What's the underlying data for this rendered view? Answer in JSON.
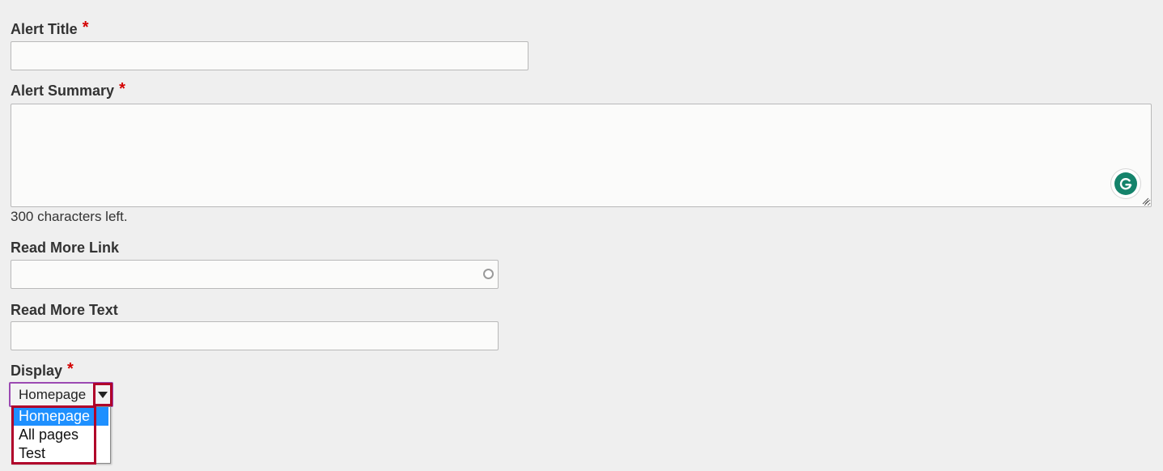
{
  "form": {
    "alert_title": {
      "label": "Alert Title",
      "required_mark": "*",
      "value": ""
    },
    "alert_summary": {
      "label": "Alert Summary",
      "required_mark": "*",
      "value": "",
      "chars_left_text": "300 characters left.",
      "grammarly_icon": "grammarly-icon"
    },
    "read_more_link": {
      "label": "Read More Link",
      "value": ""
    },
    "read_more_text": {
      "label": "Read More Text",
      "value": ""
    },
    "display": {
      "label": "Display",
      "required_mark": "*",
      "selected": "Homepage",
      "options": [
        "Homepage",
        "All pages",
        "Test"
      ],
      "highlighted_option": "Homepage"
    }
  },
  "colors": {
    "background": "#efefef",
    "required": "#d40000",
    "option_highlight": "#1e90ff",
    "annotation_border": "#b0002a",
    "select_focus_border": "#9b4ab2",
    "grammarly": "#15836b"
  }
}
